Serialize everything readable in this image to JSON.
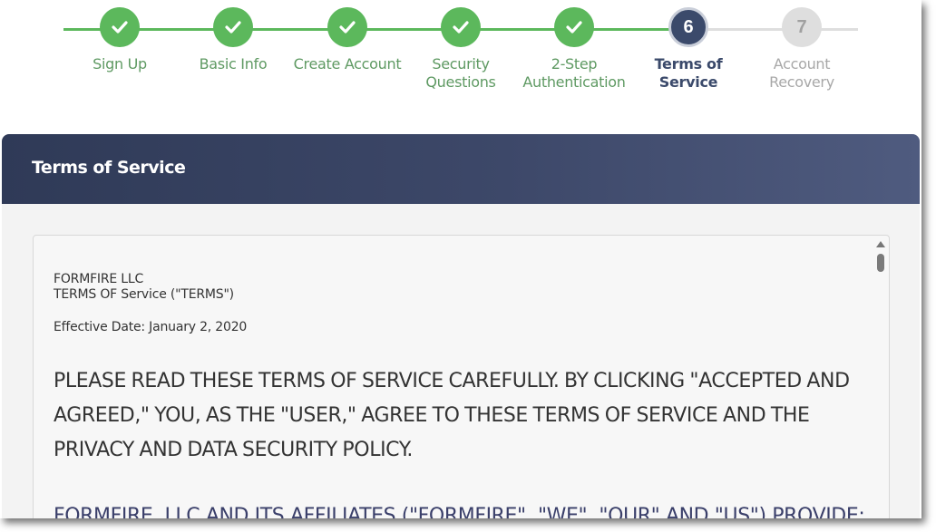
{
  "stepper": {
    "steps": [
      {
        "label": "Sign Up",
        "state": "done",
        "icon": "check-icon"
      },
      {
        "label": "Basic Info",
        "state": "done",
        "icon": "check-icon"
      },
      {
        "label": "Create Account",
        "state": "done",
        "icon": "check-icon"
      },
      {
        "label": "Security\nQuestions",
        "state": "done",
        "icon": "check-icon"
      },
      {
        "label": "2-Step\nAuthentication",
        "state": "done",
        "icon": "check-icon"
      },
      {
        "label": "Terms of\nService",
        "state": "current",
        "number": "6"
      },
      {
        "label": "Account\nRecovery",
        "state": "upcoming",
        "number": "7"
      }
    ],
    "colors": {
      "done": "#5cb85c",
      "current": "#3b4a6b",
      "upcoming": "#dedede"
    }
  },
  "panel": {
    "title": "Terms of Service",
    "header_color": "#3b4669"
  },
  "terms": {
    "company": "FORMFIRE LLC",
    "document_title": "TERMS OF Service (\"TERMS\")",
    "effective_date": "Effective Date: January 2, 2020",
    "notice": "PLEASE READ THESE TERMS OF SERVICE CAREFULLY. BY CLICKING \"ACCEPTED AND AGREED,\" YOU, AS THE \"USER,\" AGREE TO THESE TERMS OF SERVICE AND THE PRIVACY AND DATA SECURITY POLICY.",
    "paragraph_start": "FORMFIRE, LLC AND ITS AFFILIATES (\"FORMFIRE\", \"WE\", \"OUR\" AND \"US\") PROVIDE:"
  }
}
